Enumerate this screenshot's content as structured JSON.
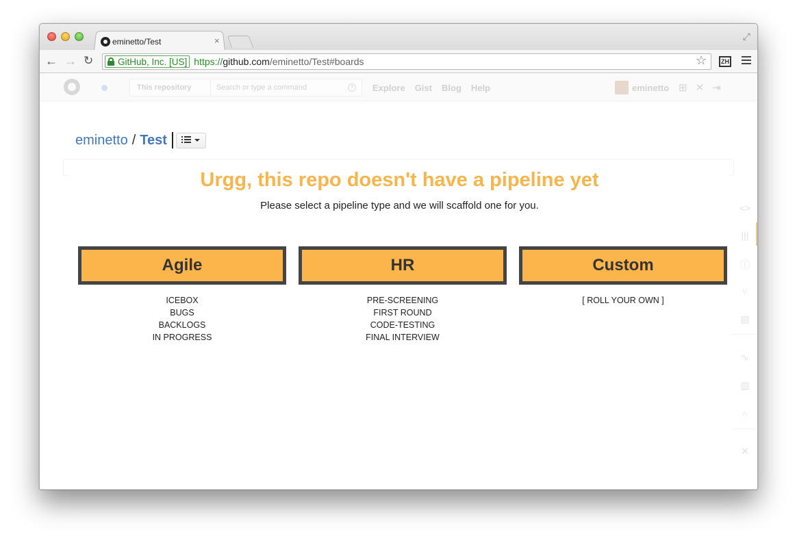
{
  "browser": {
    "tab_title": "eminetto/Test",
    "tab_close": "×",
    "ev_label": "GitHub, Inc. [US]",
    "url_scheme": "https://",
    "url_host": "github.com",
    "url_path": "/eminetto/Test#boards",
    "zh_label": "ZH"
  },
  "github_header": {
    "scope": "This repository",
    "search_placeholder": "Search or type a command",
    "nav": [
      "Explore",
      "Gist",
      "Blog",
      "Help"
    ],
    "username": "eminetto"
  },
  "breadcrumb": {
    "owner": "eminetto",
    "separator": "/",
    "repo": "Test"
  },
  "modal": {
    "heading": "Urgg, this repo doesn't have a pipeline yet",
    "subheading": "Please select a pipeline type and we will scaffold one for you.",
    "pipelines": [
      {
        "label": "Agile",
        "stages": [
          "ICEBOX",
          "BUGS",
          "BACKLOGS",
          "IN PROGRESS"
        ]
      },
      {
        "label": "HR",
        "stages": [
          "PRE-SCREENING",
          "FIRST ROUND",
          "CODE-TESTING",
          "FINAL INTERVIEW"
        ]
      },
      {
        "label": "Custom",
        "stages": [
          "[ ROLL YOUR OWN ]"
        ]
      }
    ]
  },
  "colors": {
    "accent": "#f7b54c",
    "button_fill": "#fbb54b",
    "button_border": "#444444",
    "link": "#4078c0"
  },
  "icons": {
    "right_rail": [
      "code-icon",
      "pulse-bars-icon",
      "issues-icon",
      "pull-request-icon",
      "wiki-icon",
      "pulse-icon",
      "graphs-icon",
      "network-icon",
      "settings-icon"
    ]
  }
}
